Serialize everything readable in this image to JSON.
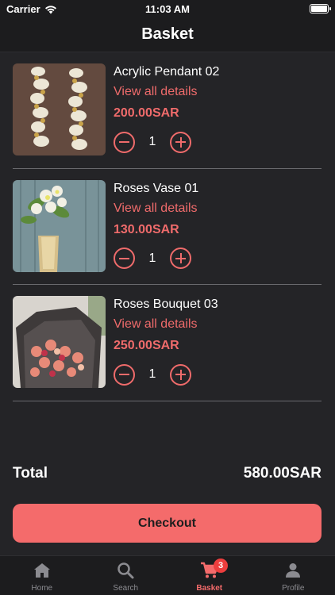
{
  "status_bar": {
    "carrier": "Carrier",
    "time": "11:03 AM"
  },
  "nav": {
    "title": "Basket"
  },
  "items": [
    {
      "name": "Acrylic Pendant 02",
      "details_link": "View all details",
      "price": "200.00SAR",
      "quantity": "1"
    },
    {
      "name": "Roses Vase 01",
      "details_link": "View all details",
      "price": "130.00SAR",
      "quantity": "1"
    },
    {
      "name": "Roses Bouquet 03",
      "details_link": "View all details",
      "price": "250.00SAR",
      "quantity": "1"
    }
  ],
  "summary": {
    "total_label": "Total",
    "total_value": "580.00SAR"
  },
  "checkout": {
    "label": "Checkout"
  },
  "tabbar": {
    "tabs": [
      {
        "label": "Home",
        "icon": "home-icon"
      },
      {
        "label": "Search",
        "icon": "search-icon"
      },
      {
        "label": "Basket",
        "icon": "cart-icon",
        "badge": "3",
        "active": true
      },
      {
        "label": "Profile",
        "icon": "person-icon"
      }
    ]
  },
  "colors": {
    "accent": "#f46b6b",
    "background": "#242427",
    "bar": "#1c1c1e",
    "badge": "#ee3e3e"
  }
}
